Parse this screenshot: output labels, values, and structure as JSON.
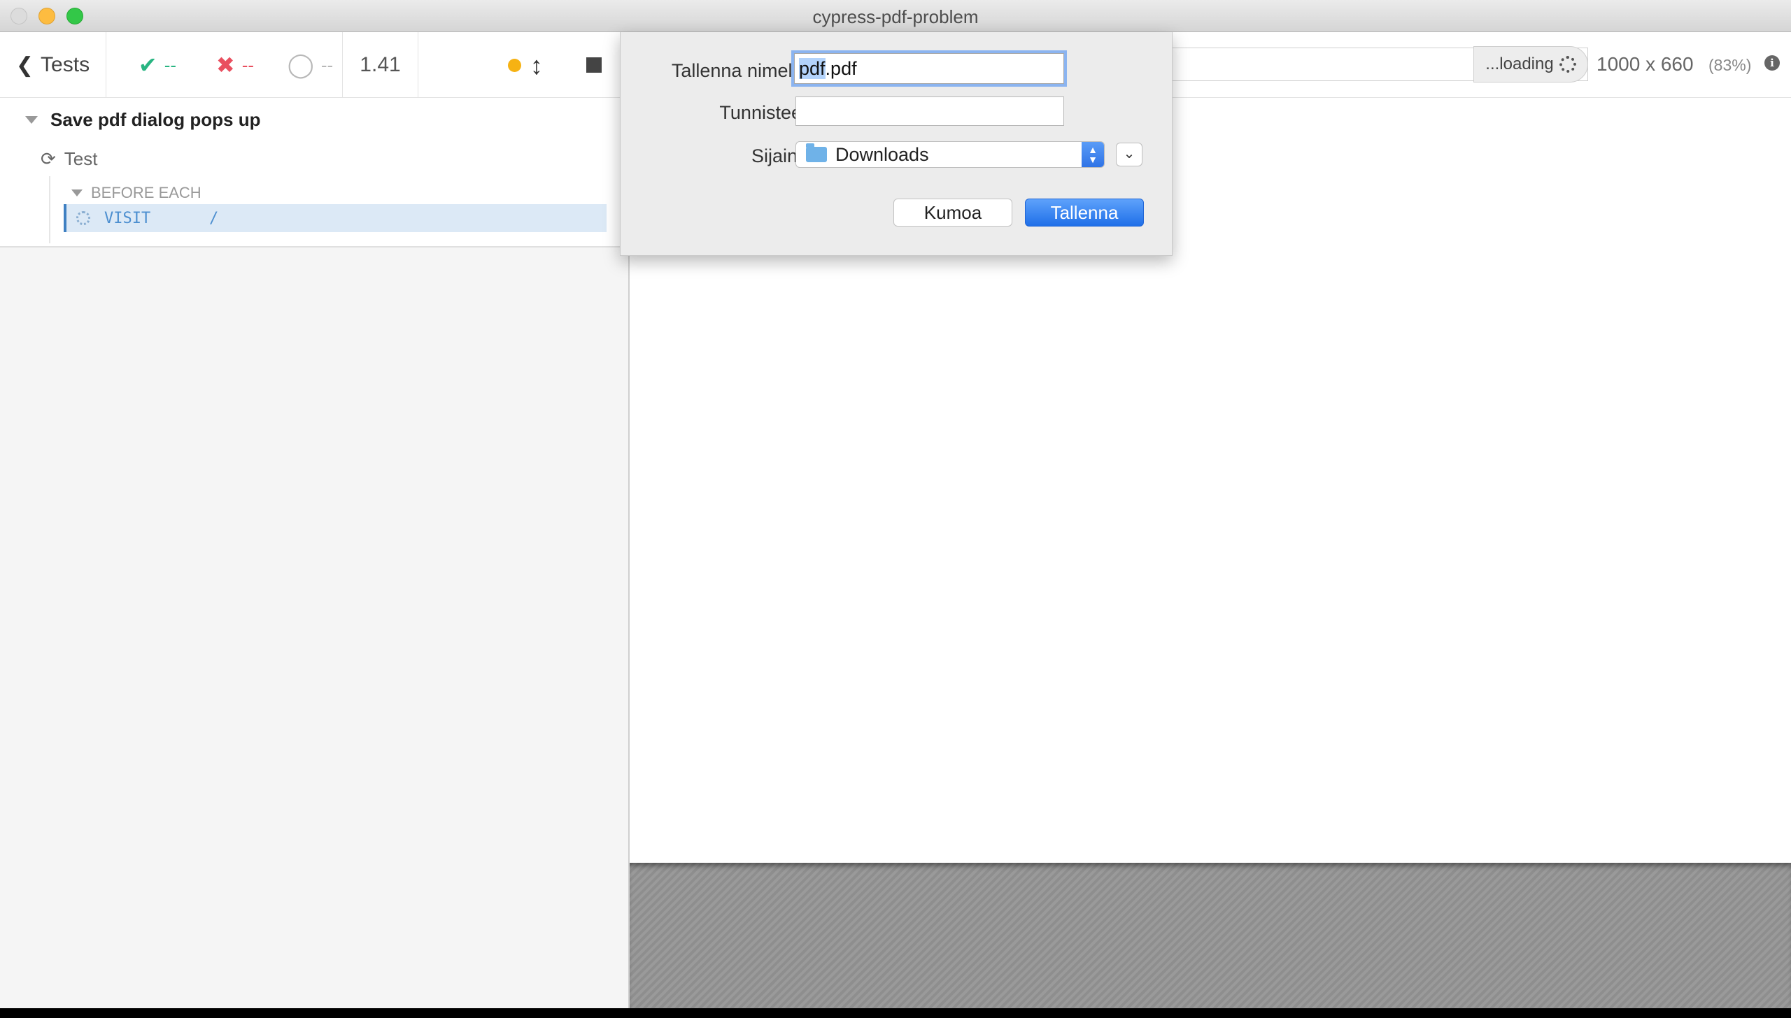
{
  "window": {
    "title": "cypress-pdf-problem"
  },
  "header": {
    "tests_label": "Tests",
    "passed": "--",
    "failed": "--",
    "pending": "--",
    "duration": "1.41"
  },
  "reporter": {
    "suite_title": "Save pdf dialog pops up",
    "test_title": "Test",
    "hook_title": "BEFORE EACH",
    "command": {
      "name": "VISIT",
      "message": "/"
    }
  },
  "aut": {
    "url": "",
    "loading_text": "...loading",
    "viewport_size": "1000 x 660",
    "viewport_scale": "(83%)"
  },
  "save_dialog": {
    "name_label": "Tallenna nimellä:",
    "name_selected": "pdf",
    "name_rest": ".pdf",
    "tags_label": "Tunnisteet:",
    "tags_value": "",
    "where_label": "Sijainti:",
    "where_value": "Downloads",
    "cancel_label": "Kumoa",
    "save_label": "Tallenna"
  },
  "colors": {
    "passed": "#29b582",
    "failed": "#e94f5f",
    "running": "#f6b213",
    "accent": "#3f80c2",
    "primary_button": "#1f6fe8"
  },
  "icons": {
    "back": "chevron-left-icon",
    "passed": "check-icon",
    "failed": "x-icon",
    "pending": "circle-icon",
    "running": "dot-icon",
    "resize": "arrows-vertical-icon",
    "stop": "square-stop-icon",
    "test_running": "refresh-icon",
    "info": "info-icon",
    "folder": "folder-icon"
  }
}
